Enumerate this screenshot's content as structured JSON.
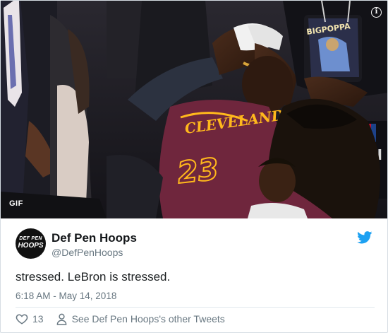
{
  "media": {
    "badge": "GIF",
    "info_icon": "info-icon",
    "jersey_text": "CLEVELAND",
    "jersey_number": "23",
    "shirt_text": "BIGPOPPA"
  },
  "author": {
    "avatar_line1": "DEF PEN",
    "avatar_line2": "HOOPS",
    "display_name": "Def Pen Hoops",
    "handle": "@DefPenHoops",
    "brand_icon": "twitter-bird-icon"
  },
  "tweet": {
    "text": "stressed. LeBron is stressed.",
    "timestamp": "6:18 AM - May 14, 2018"
  },
  "actions": {
    "like_count": "13",
    "other_tweets_label": "See Def Pen Hoops's other Tweets"
  },
  "colors": {
    "link_blue": "#1da1f2",
    "muted": "#697882",
    "jersey_wine": "#6f263d",
    "jersey_gold": "#ffb81c"
  }
}
